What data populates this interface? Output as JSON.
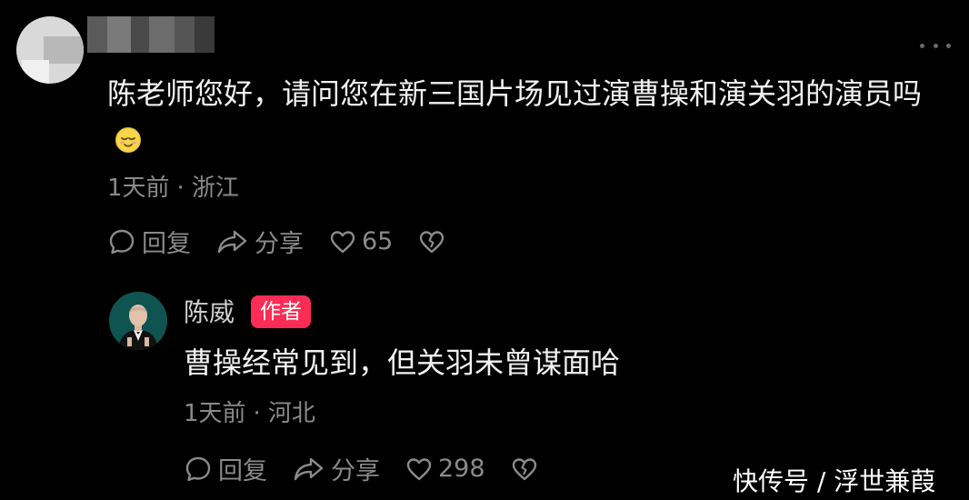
{
  "comment": {
    "text": "陈老师您好，请问您在新三国片场见过演曹操和演关羽的演员吗",
    "emoji_icon": "relieved-face-emoji-icon",
    "time": "1天前",
    "separator": "·",
    "location": "浙江",
    "actions": {
      "reply_label": "回复",
      "share_label": "分享",
      "like_count": "65"
    }
  },
  "reply": {
    "username": "陈威",
    "badge": "作者",
    "text": "曹操经常见到，但关羽未曾谋面哈",
    "time": "1天前",
    "separator": "·",
    "location": "河北",
    "actions": {
      "reply_label": "回复",
      "share_label": "分享",
      "like_count": "298"
    }
  },
  "watermark": "快传号 / 浮世兼葭",
  "colors": {
    "background": "#000000",
    "text": "#f2f2f2",
    "meta": "#8a8a8a",
    "badge": "#fb2c55"
  }
}
